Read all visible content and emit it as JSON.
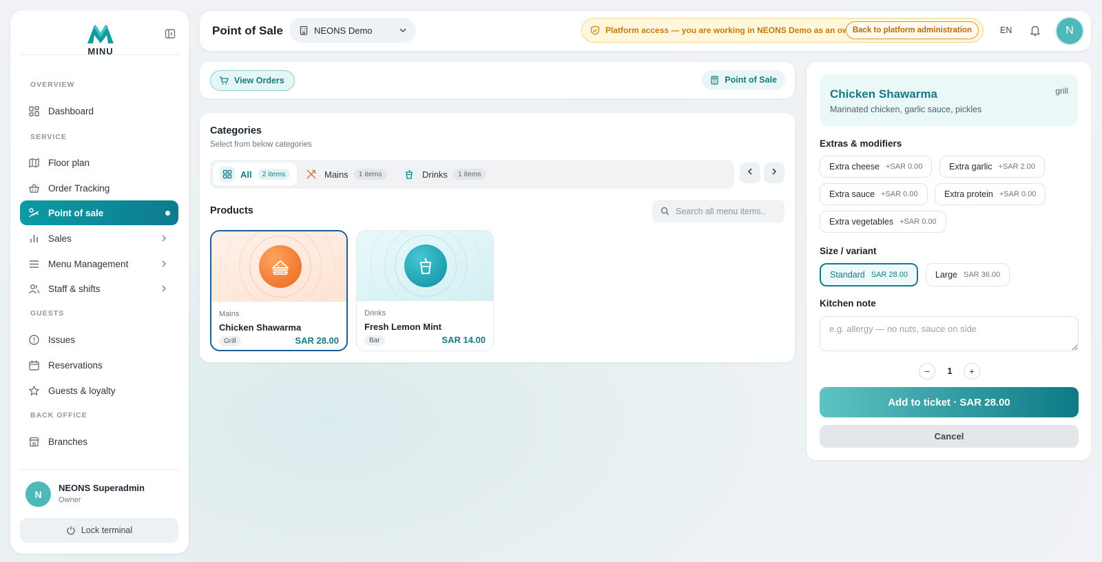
{
  "app": {
    "logo_text": "MINU",
    "brand_color": "#0f9aa3"
  },
  "sidebar": {
    "sections": [
      {
        "label": "OVERVIEW"
      },
      {
        "label": "SERVICE"
      },
      {
        "label": "GUESTS"
      },
      {
        "label": "BACK OFFICE"
      }
    ],
    "items": [
      {
        "label": "Dashboard",
        "icon": "dashboard-icon"
      },
      {
        "label": "Floor plan",
        "icon": "map-icon"
      },
      {
        "label": "Order Tracking",
        "icon": "basket-icon"
      },
      {
        "label": "Point of sale",
        "icon": "pos-icon",
        "active": true
      },
      {
        "label": "Sales",
        "icon": "bar-chart-icon"
      },
      {
        "label": "Menu Management",
        "icon": "menu-icon"
      },
      {
        "label": "Staff & shifts",
        "icon": "users-icon"
      },
      {
        "label": "Issues",
        "icon": "alert-icon"
      },
      {
        "label": "Reservations",
        "icon": "calendar-icon"
      },
      {
        "label": "Guests & loyalty",
        "icon": "star-icon"
      },
      {
        "label": "Branches",
        "icon": "store-icon"
      }
    ],
    "user": {
      "initial": "N",
      "name": "NEONS Superadmin",
      "role": "Owner"
    },
    "lock_label": "Lock terminal"
  },
  "header": {
    "title": "Point of Sale",
    "branch": "NEONS Demo",
    "banner_text": "Platform access — you are working in NEONS Demo as an owner.",
    "banner_button": "Back to platform administration",
    "language": "EN",
    "avatar_initial": "N"
  },
  "toolbar": {
    "view_orders": "View Orders",
    "mode_label": "Point of Sale"
  },
  "categories": {
    "title": "Categories",
    "subtitle": "Select from below categories",
    "tabs": [
      {
        "label": "All",
        "count": "2 items",
        "active": true
      },
      {
        "label": "Mains",
        "count": "1 items"
      },
      {
        "label": "Drinks",
        "count": "1 items"
      }
    ]
  },
  "products": {
    "title": "Products",
    "search_placeholder": "Search all menu items..",
    "items": [
      {
        "category": "Mains",
        "name": "Chicken Shawarma",
        "tag": "Grill",
        "price": "SAR 28.00",
        "icon": "sandwich-icon",
        "color": "#f07b2c"
      },
      {
        "category": "Drinks",
        "name": "Fresh Lemon Mint",
        "tag": "Bar",
        "price": "SAR 14.00",
        "icon": "cup-icon",
        "color": "#1aa3b3"
      }
    ]
  },
  "panel": {
    "item_name": "Chicken Shawarma",
    "item_description": "Marinated chicken, garlic sauce, pickles",
    "station": "grill",
    "extras_title": "Extras & modifiers",
    "extras": [
      {
        "name": "Extra cheese",
        "price": "+SAR 0.00"
      },
      {
        "name": "Extra garlic",
        "price": "+SAR 2.00"
      },
      {
        "name": "Extra sauce",
        "price": "+SAR 0.00"
      },
      {
        "name": "Extra protein",
        "price": "+SAR 0.00"
      },
      {
        "name": "Extra vegetables",
        "price": "+SAR 0.00"
      }
    ],
    "size_title": "Size / variant",
    "sizes": [
      {
        "name": "Standard",
        "price": "SAR 28.00",
        "selected": true
      },
      {
        "name": "Large",
        "price": "SAR 36.00"
      }
    ],
    "note_title": "Kitchen note",
    "note_placeholder": "e.g. allergy — no nuts, sauce on side",
    "quantity": "1",
    "qty_minus": "−",
    "qty_plus": "+",
    "add_button": "Add to ticket · SAR 28.00",
    "cancel_button": "Cancel"
  }
}
